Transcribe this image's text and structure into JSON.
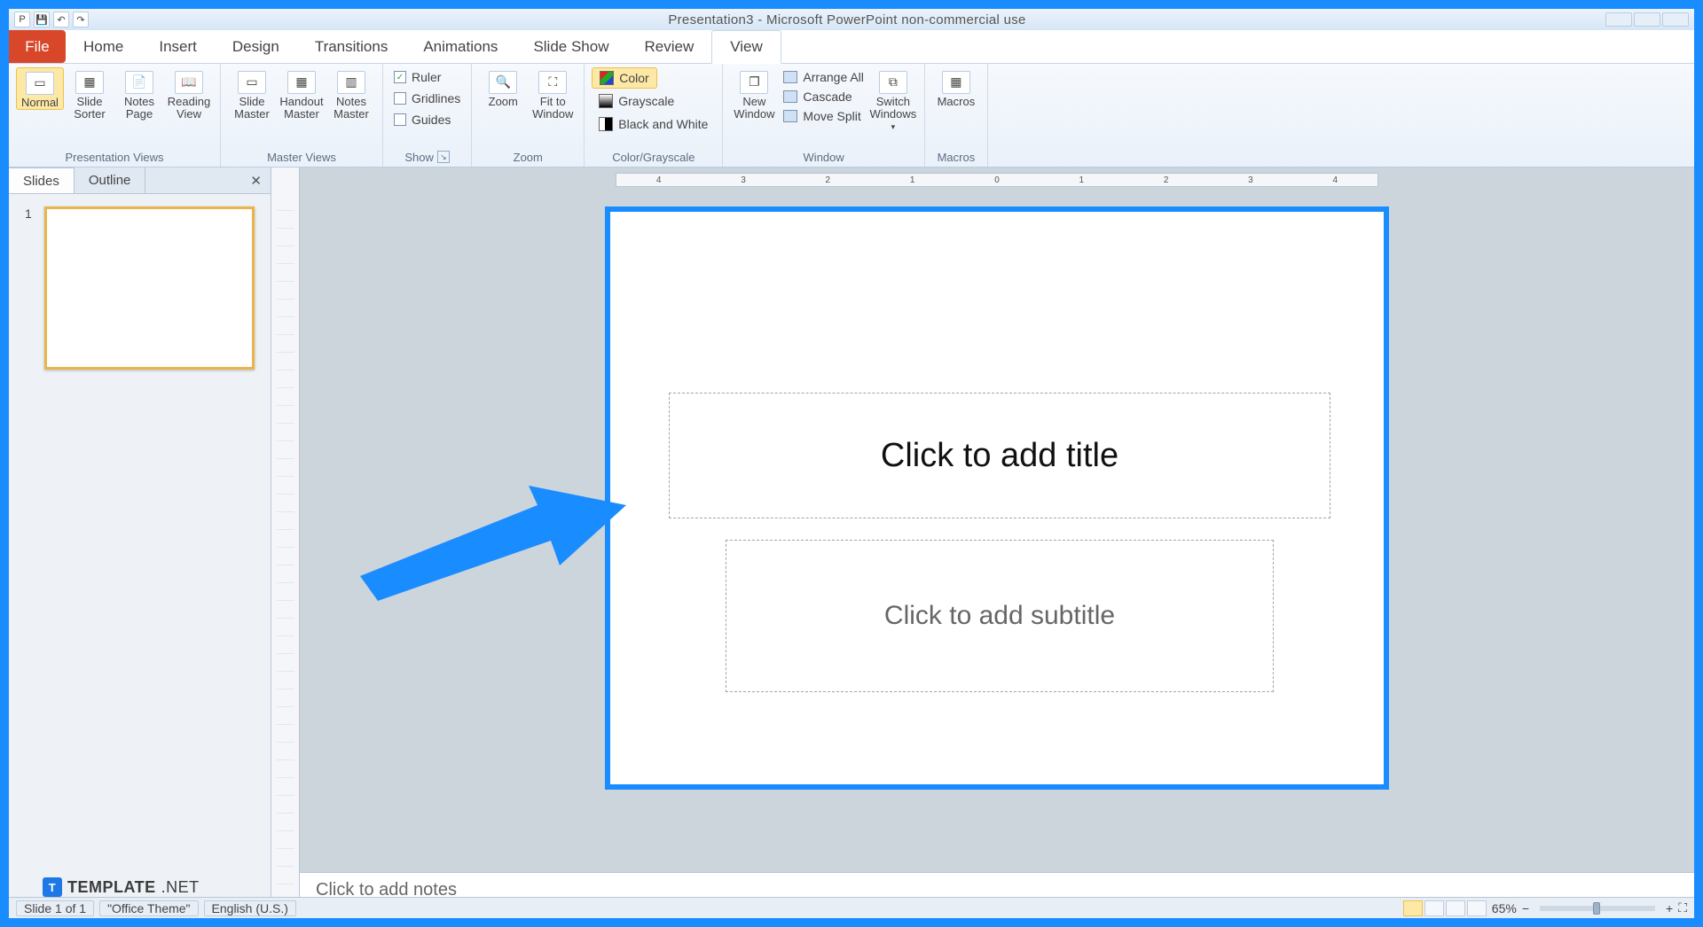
{
  "titlebar": {
    "title": "Presentation3 - Microsoft PowerPoint non-commercial use"
  },
  "tabs": {
    "file": "File",
    "items": [
      "Home",
      "Insert",
      "Design",
      "Transitions",
      "Animations",
      "Slide Show",
      "Review",
      "View"
    ],
    "active": "View"
  },
  "ribbon": {
    "groups": {
      "presentation_views": {
        "label": "Presentation Views",
        "buttons": {
          "normal": "Normal",
          "sorter": "Slide Sorter",
          "notes": "Notes Page",
          "reading": "Reading View"
        }
      },
      "master_views": {
        "label": "Master Views",
        "buttons": {
          "slide": "Slide Master",
          "handout": "Handout Master",
          "notes": "Notes Master"
        }
      },
      "show": {
        "label": "Show",
        "items": {
          "ruler": "Ruler",
          "gridlines": "Gridlines",
          "guides": "Guides"
        },
        "checked": {
          "ruler": true,
          "gridlines": false,
          "guides": false
        }
      },
      "zoom": {
        "label": "Zoom",
        "buttons": {
          "zoom": "Zoom",
          "fit": "Fit to Window"
        }
      },
      "color": {
        "label": "Color/Grayscale",
        "items": {
          "color": "Color",
          "grayscale": "Grayscale",
          "bw": "Black and White"
        }
      },
      "window": {
        "label": "Window",
        "new_window": "New Window",
        "switch": "Switch Windows",
        "items": {
          "arrange": "Arrange All",
          "cascade": "Cascade",
          "move_split": "Move Split"
        }
      },
      "macros": {
        "label": "Macros",
        "button": "Macros"
      }
    }
  },
  "navpanel": {
    "tabs": {
      "slides": "Slides",
      "outline": "Outline"
    },
    "thumb_number": "1"
  },
  "hruler_marks": [
    "4",
    "3",
    "2",
    "1",
    "0",
    "1",
    "2",
    "3",
    "4"
  ],
  "slide": {
    "title_placeholder": "Click to add title",
    "subtitle_placeholder": "Click to add subtitle"
  },
  "notes_placeholder": "Click to add notes",
  "watermark": {
    "badge": "T",
    "text": "TEMPLATE",
    "suffix": ".NET"
  },
  "statusbar": {
    "slide_counter": "Slide 1 of 1",
    "theme": "\"Office Theme\"",
    "language": "English (U.S.)",
    "zoom": "65%"
  }
}
